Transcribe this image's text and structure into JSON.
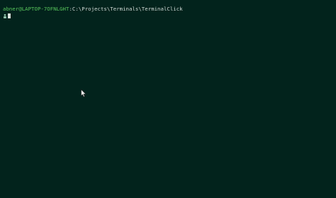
{
  "colors": {
    "background": "#02231c",
    "user_host": "#56c35b",
    "path": "#cfd8d4",
    "prompt_icon": "#8fbfa8",
    "cursor": "#d7e2dc",
    "mouse_pointer": "#e8ece9"
  },
  "terminal": {
    "user_host": "abner@LAPTOP-7OFNLGHT",
    "separator": ":",
    "path": "C:\\Projects\\Terminals\\TerminalClick"
  },
  "icons": {
    "prompt": "prompt-glyph-icon",
    "pointer": "mouse-pointer-icon"
  }
}
